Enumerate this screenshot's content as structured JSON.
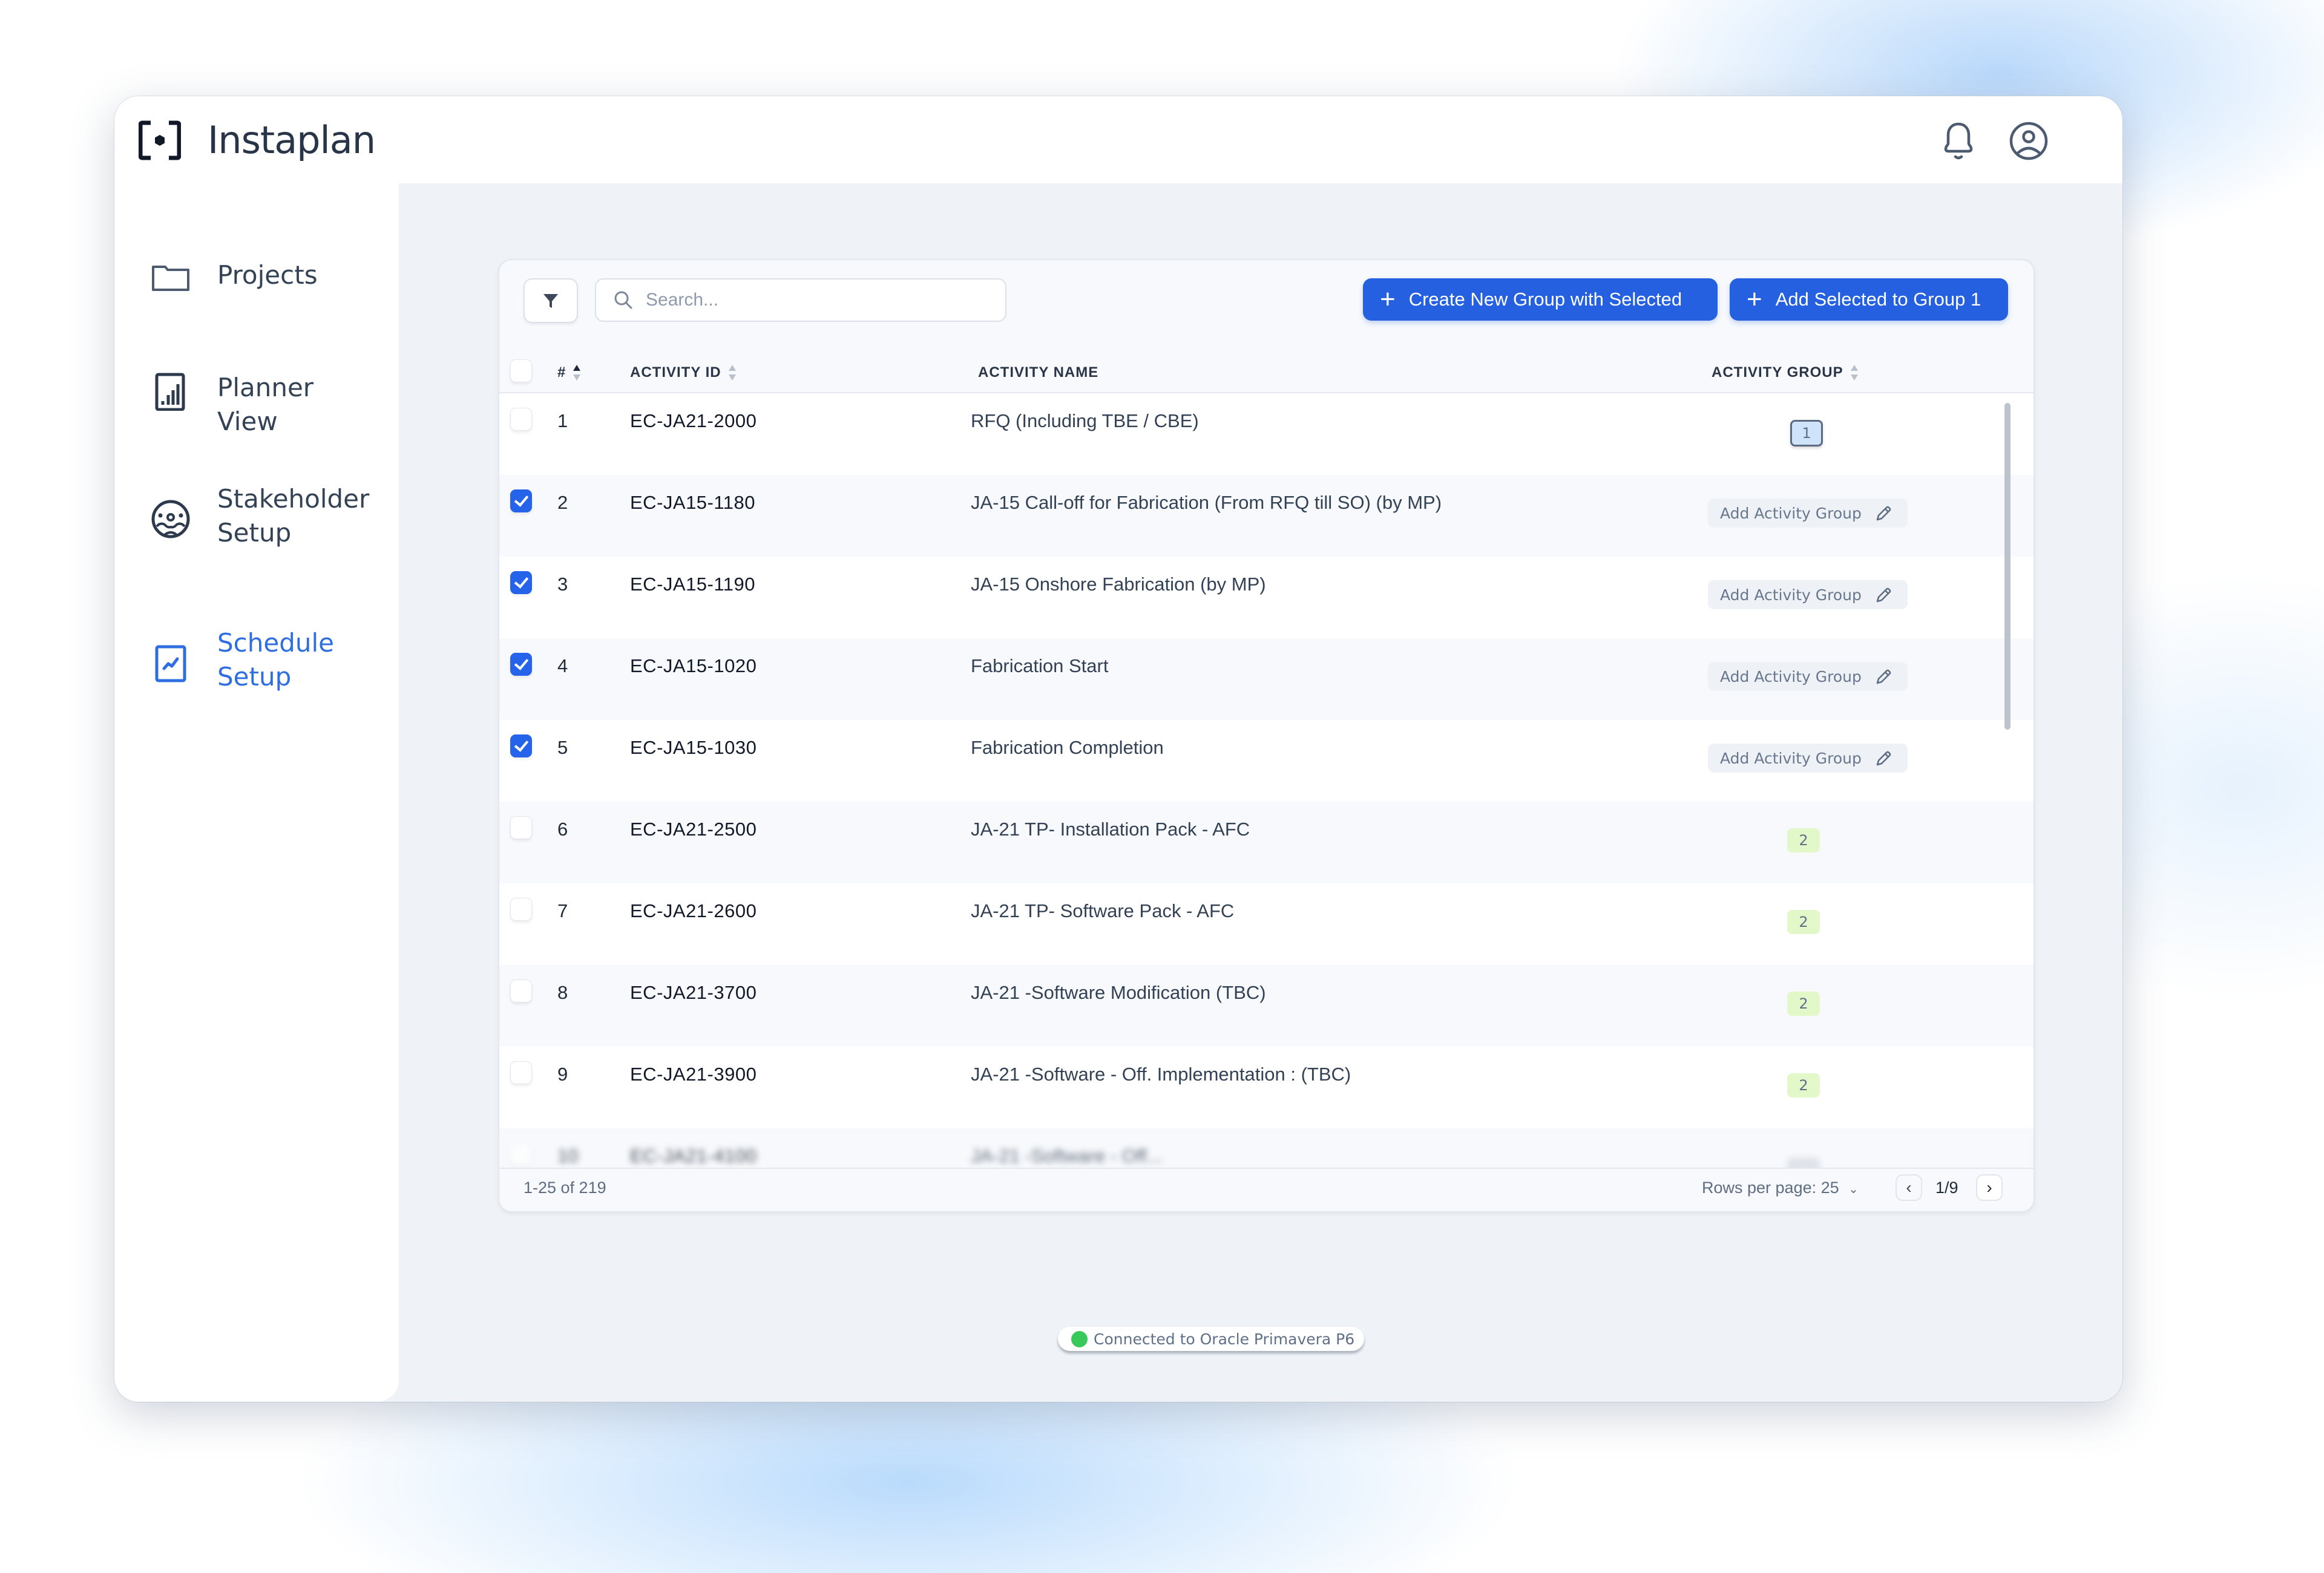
{
  "app": {
    "name": "Instaplan"
  },
  "header": {
    "icons": [
      "bell-icon",
      "user-circle-icon"
    ]
  },
  "sidebar": {
    "items": [
      {
        "label": "Projects",
        "icon": "folder-icon",
        "active": false
      },
      {
        "label": "Planner View",
        "icon": "bar-chart-icon",
        "active": false
      },
      {
        "label": "Stakeholder Setup",
        "icon": "stakeholders-icon",
        "active": false
      },
      {
        "label": "Schedule Setup",
        "icon": "schedule-chart-icon",
        "active": true
      }
    ]
  },
  "toolbar": {
    "filter_icon": "filter-icon",
    "search_placeholder": "Search...",
    "search_value": "",
    "create_group_label": "Create New Group with Selected",
    "add_to_group_label": "Add Selected to Group 1"
  },
  "table": {
    "columns": {
      "num": "#",
      "activity_id": "ACTIVITY ID",
      "activity_name": "ACTIVITY NAME",
      "activity_group": "ACTIVITY GROUP"
    },
    "sort": {
      "column": "#",
      "direction": "ascending"
    },
    "add_group_label": "Add Activity Group",
    "rows": [
      {
        "num": "1",
        "id": "EC-JA21-2000",
        "name": "RFQ (Including TBE / CBE)",
        "checked": false,
        "group": "1"
      },
      {
        "num": "2",
        "id": "EC-JA15-1180",
        "name": "JA-15 Call-off for Fabrication (From RFQ till SO)  (by MP)",
        "checked": true,
        "group": null
      },
      {
        "num": "3",
        "id": "EC-JA15-1190",
        "name": "JA-15 Onshore Fabrication  (by MP)",
        "checked": true,
        "group": null
      },
      {
        "num": "4",
        "id": "EC-JA15-1020",
        "name": "Fabrication Start",
        "checked": true,
        "group": null
      },
      {
        "num": "5",
        "id": "EC-JA15-1030",
        "name": "Fabrication Completion",
        "checked": true,
        "group": null
      },
      {
        "num": "6",
        "id": "EC-JA21-2500",
        "name": "JA-21 TP- Installation Pack - AFC",
        "checked": false,
        "group": "2"
      },
      {
        "num": "7",
        "id": "EC-JA21-2600",
        "name": "JA-21 TP- Software Pack - AFC",
        "checked": false,
        "group": "2"
      },
      {
        "num": "8",
        "id": "EC-JA21-3700",
        "name": "JA-21 -Software Modification (TBC)",
        "checked": false,
        "group": "2"
      },
      {
        "num": "9",
        "id": "EC-JA21-3900",
        "name": "JA-21 -Software  - Off. Implementation :  (TBC)",
        "checked": false,
        "group": "2"
      },
      {
        "num": "10",
        "id": "EC-JA21-4100",
        "name": "JA-21 -Software - Off...",
        "checked": false,
        "group": ""
      }
    ]
  },
  "footer": {
    "count_text": "1-25 of 219",
    "rows_per_page_label": "Rows per page: 25",
    "page_label": "1/9"
  },
  "status": {
    "text": "Connected to Oracle Primavera P6",
    "color": "#38c95a"
  },
  "colors": {
    "accent": "#2460e0",
    "group1_badge": "#cfe3fb",
    "group2_badge": "#e2f8c9"
  }
}
